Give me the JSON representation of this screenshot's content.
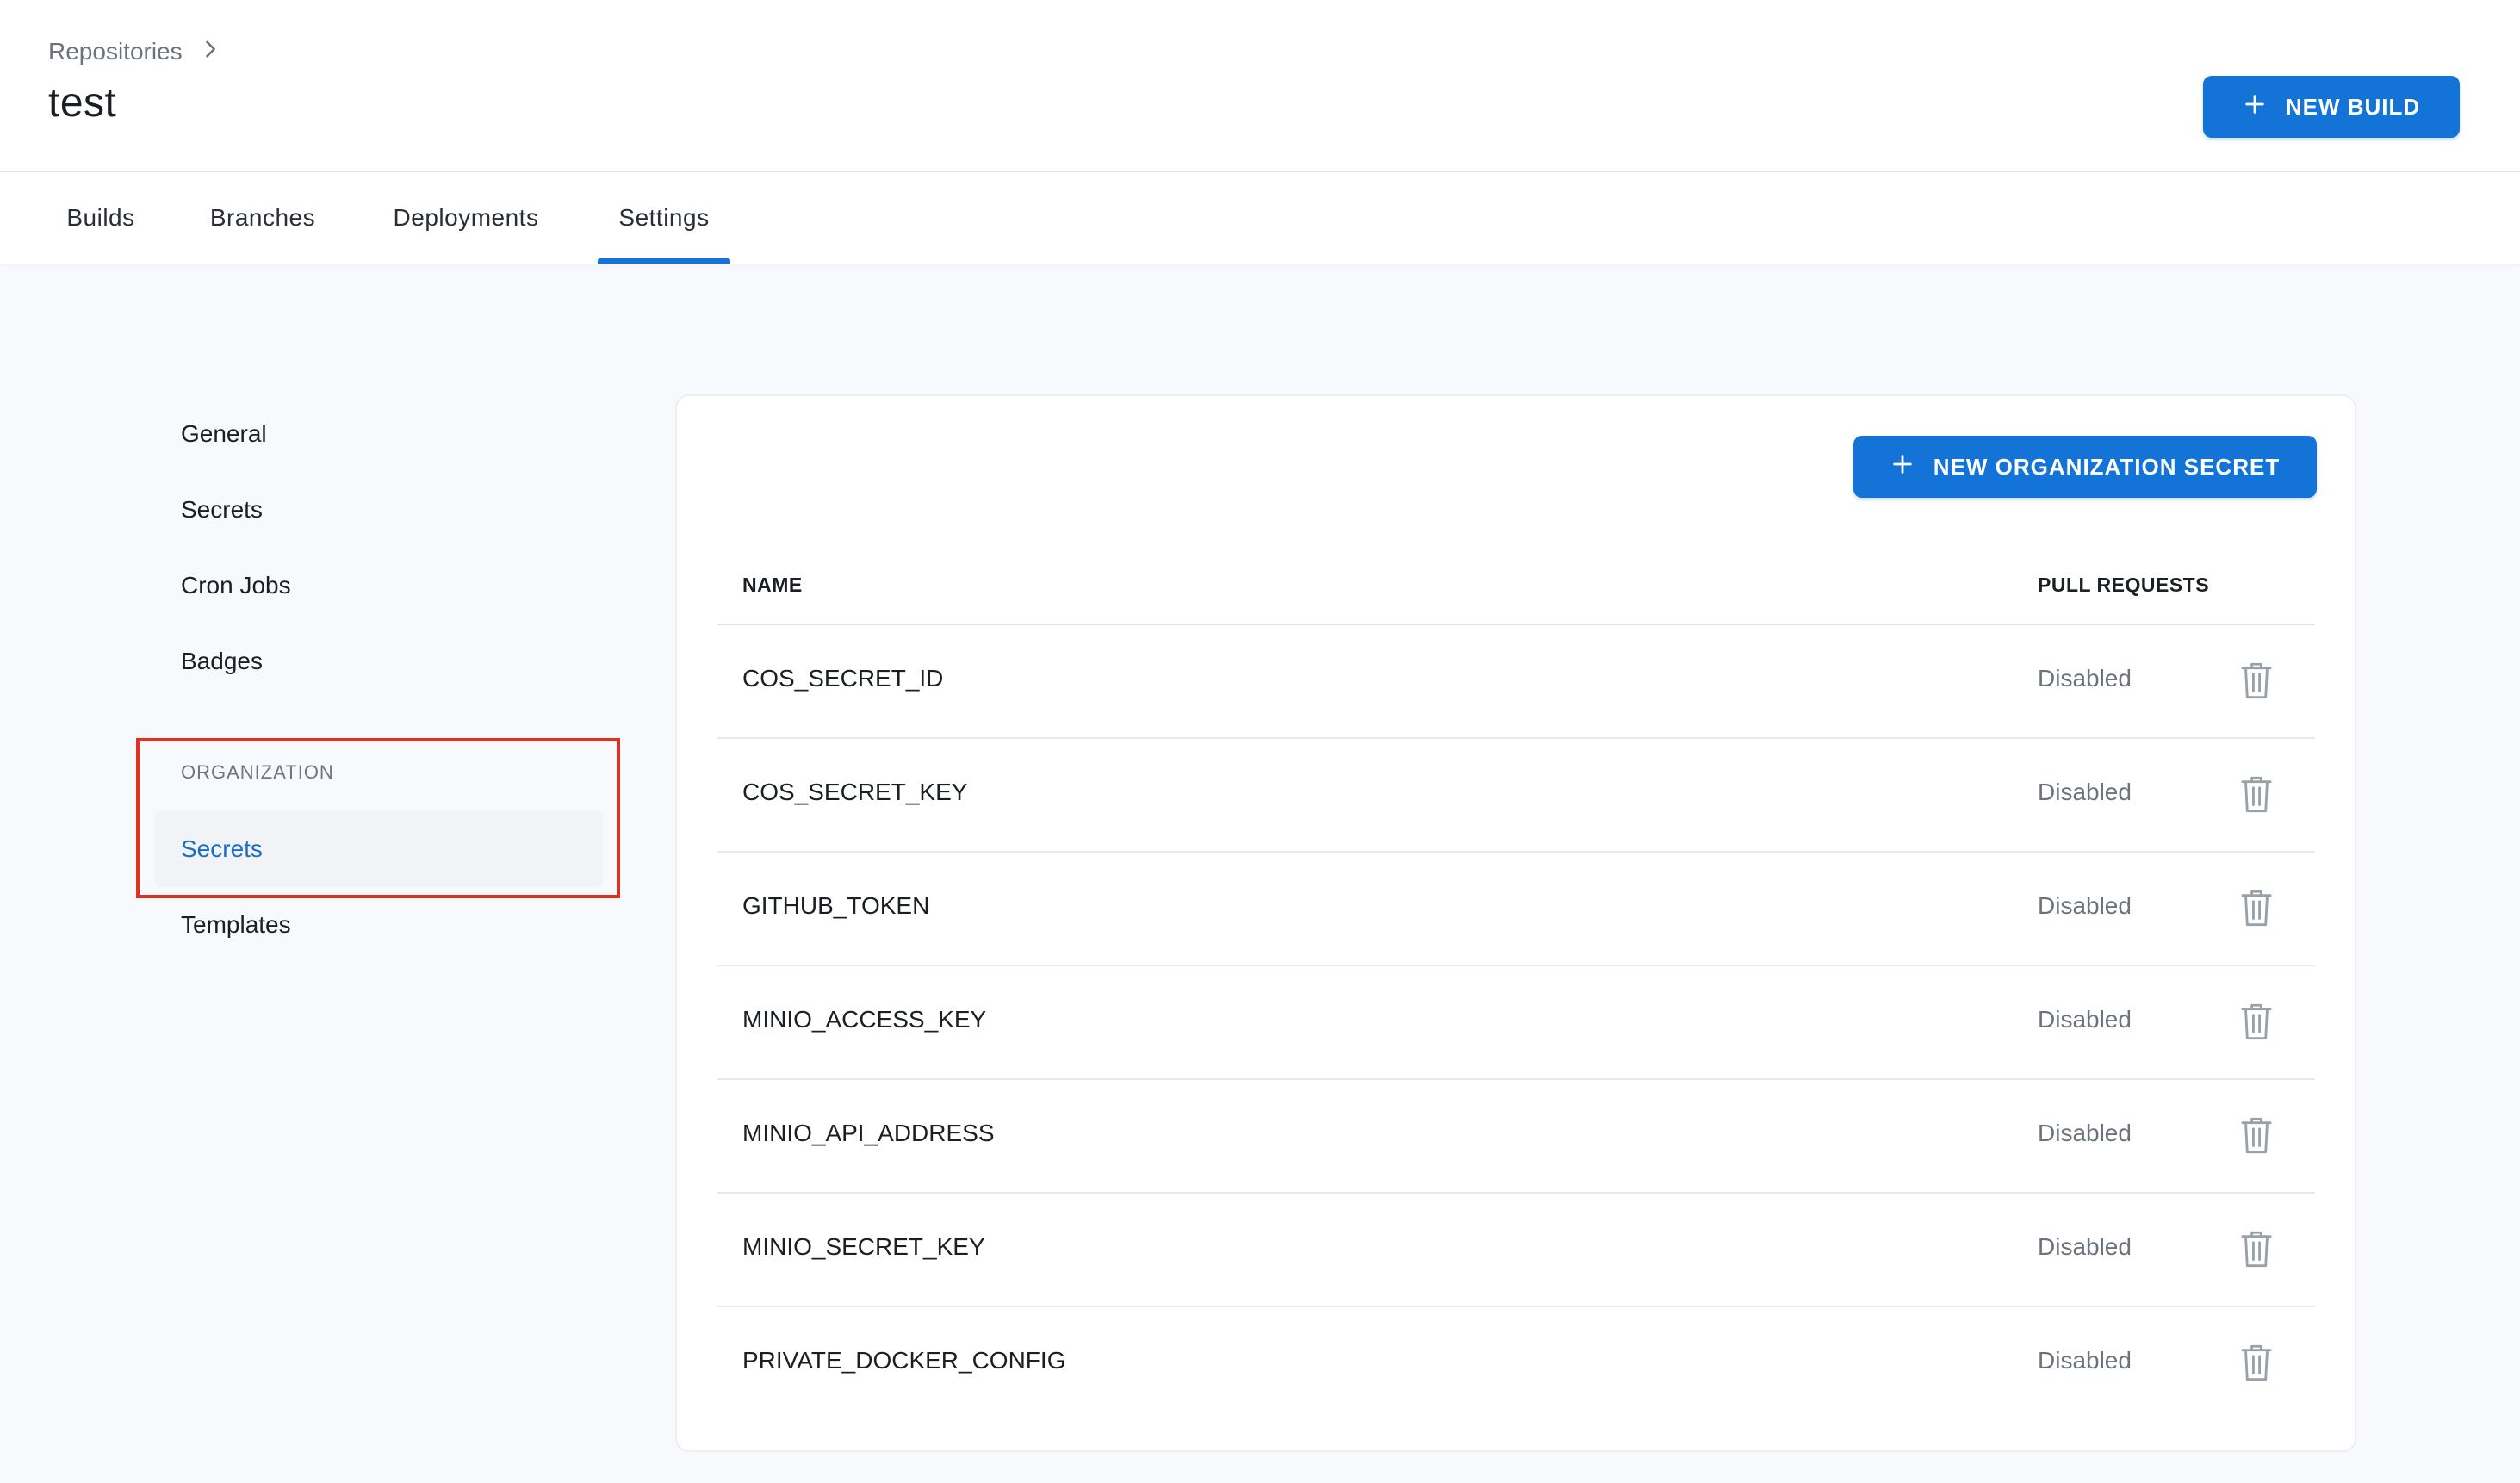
{
  "breadcrumb": {
    "parent": "Repositories"
  },
  "page": {
    "title": "test"
  },
  "header": {
    "new_build_label": "NEW BUILD"
  },
  "tabs": [
    {
      "label": "Builds",
      "active": false
    },
    {
      "label": "Branches",
      "active": false
    },
    {
      "label": "Deployments",
      "active": false
    },
    {
      "label": "Settings",
      "active": true
    }
  ],
  "sidenav": {
    "items": [
      {
        "label": "General"
      },
      {
        "label": "Secrets"
      },
      {
        "label": "Cron Jobs"
      },
      {
        "label": "Badges"
      }
    ],
    "section_label": "ORGANIZATION",
    "org_items": [
      {
        "label": "Secrets",
        "selected": true
      },
      {
        "label": "Templates",
        "selected": false
      }
    ]
  },
  "card": {
    "new_secret_label": "NEW ORGANIZATION SECRET"
  },
  "table": {
    "columns": {
      "name": "NAME",
      "pull_requests": "PULL REQUESTS"
    },
    "rows": [
      {
        "name": "COS_SECRET_ID",
        "pull_requests": "Disabled"
      },
      {
        "name": "COS_SECRET_KEY",
        "pull_requests": "Disabled"
      },
      {
        "name": "GITHUB_TOKEN",
        "pull_requests": "Disabled"
      },
      {
        "name": "MINIO_ACCESS_KEY",
        "pull_requests": "Disabled"
      },
      {
        "name": "MINIO_API_ADDRESS",
        "pull_requests": "Disabled"
      },
      {
        "name": "MINIO_SECRET_KEY",
        "pull_requests": "Disabled"
      },
      {
        "name": "PRIVATE_DOCKER_CONFIG",
        "pull_requests": "Disabled"
      }
    ]
  },
  "colors": {
    "accent": "#1473d6",
    "selected_text": "#1a6ec4",
    "highlight_box": "#e0301e",
    "page_bg": "#f8f9fc"
  },
  "icons": {
    "breadcrumb_separator": "chevron-right-icon",
    "add": "plus-icon",
    "delete": "trash-icon"
  }
}
